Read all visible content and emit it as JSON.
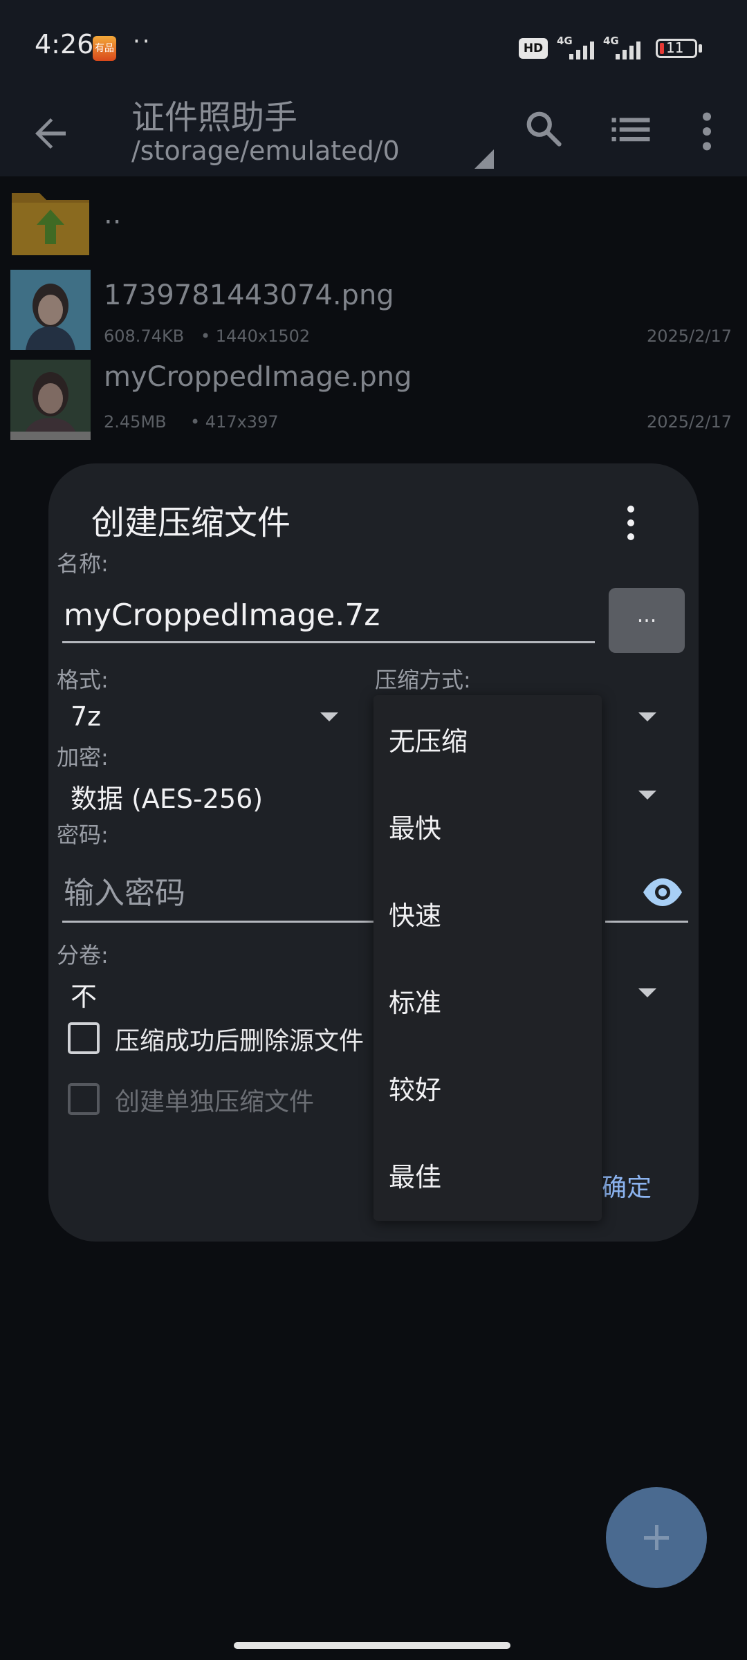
{
  "status_bar": {
    "time": "4:26",
    "badge_text": "有品",
    "dots": "··",
    "hd": "HD",
    "network1": "4G",
    "network2": "4G",
    "battery": "11"
  },
  "toolbar": {
    "title": "证件照助手",
    "path": "/storage/emulated/0"
  },
  "files": [
    {
      "name": "..",
      "type": "parent-folder"
    },
    {
      "name": "1739781443074.png",
      "size": "608.74KB",
      "dimensions": "• 1440x1502",
      "date": "2025/2/17"
    },
    {
      "name": "myCroppedImage.png",
      "size": "2.45MB",
      "dimensions": "• 417x397",
      "date": "2025/2/17"
    }
  ],
  "dialog": {
    "title": "创建压缩文件",
    "name_label": "名称:",
    "name_value": "myCroppedImage.7z",
    "browse_label": "...",
    "format_label": "格式:",
    "format_value": "7z",
    "compression_label": "压缩方式:",
    "encryption_label": "加密:",
    "encryption_value": "数据 (AES-256)",
    "password_label": "密码:",
    "password_placeholder": "输入密码",
    "split_label": "分卷:",
    "split_value": "不",
    "delete_source_label": "压缩成功后删除源文件",
    "separate_archive_label": "创建单独压缩文件",
    "ok_label": "确定"
  },
  "compression_options": [
    "无压缩",
    "最快",
    "快速",
    "标准",
    "较好",
    "最佳"
  ],
  "colors": {
    "background": "#0b0d11",
    "appbar": "#151921",
    "dialog": "#1e2126",
    "accent": "#8cb4f0",
    "eye_icon": "#a8cff5",
    "fab": "#4a6a90"
  }
}
